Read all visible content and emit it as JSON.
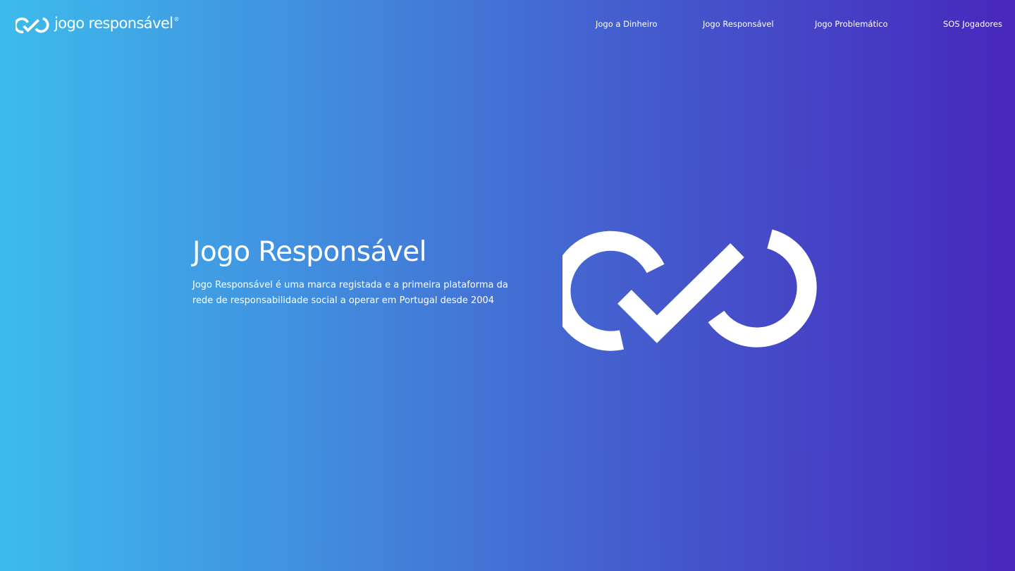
{
  "header": {
    "logo_text": "jogo responsável",
    "logo_reg_mark": "®",
    "logo_icon": "infinity-check-icon"
  },
  "nav": {
    "items": [
      {
        "label": "Jogo a Dinheiro"
      },
      {
        "label": "Jogo Responsável"
      },
      {
        "label": "Jogo Problemático"
      },
      {
        "label": "SOS Jogadores"
      }
    ]
  },
  "hero": {
    "title": "Jogo Responsável",
    "description": "Jogo Responsável é uma marca registada e a primeira plataforma da rede de responsabilidade social a operar em Portugal desde 2004",
    "logo_icon": "infinity-check-icon"
  },
  "colors": {
    "gradient_start": "#3dbbec",
    "gradient_end": "#4727bc",
    "text": "#ffffff"
  }
}
